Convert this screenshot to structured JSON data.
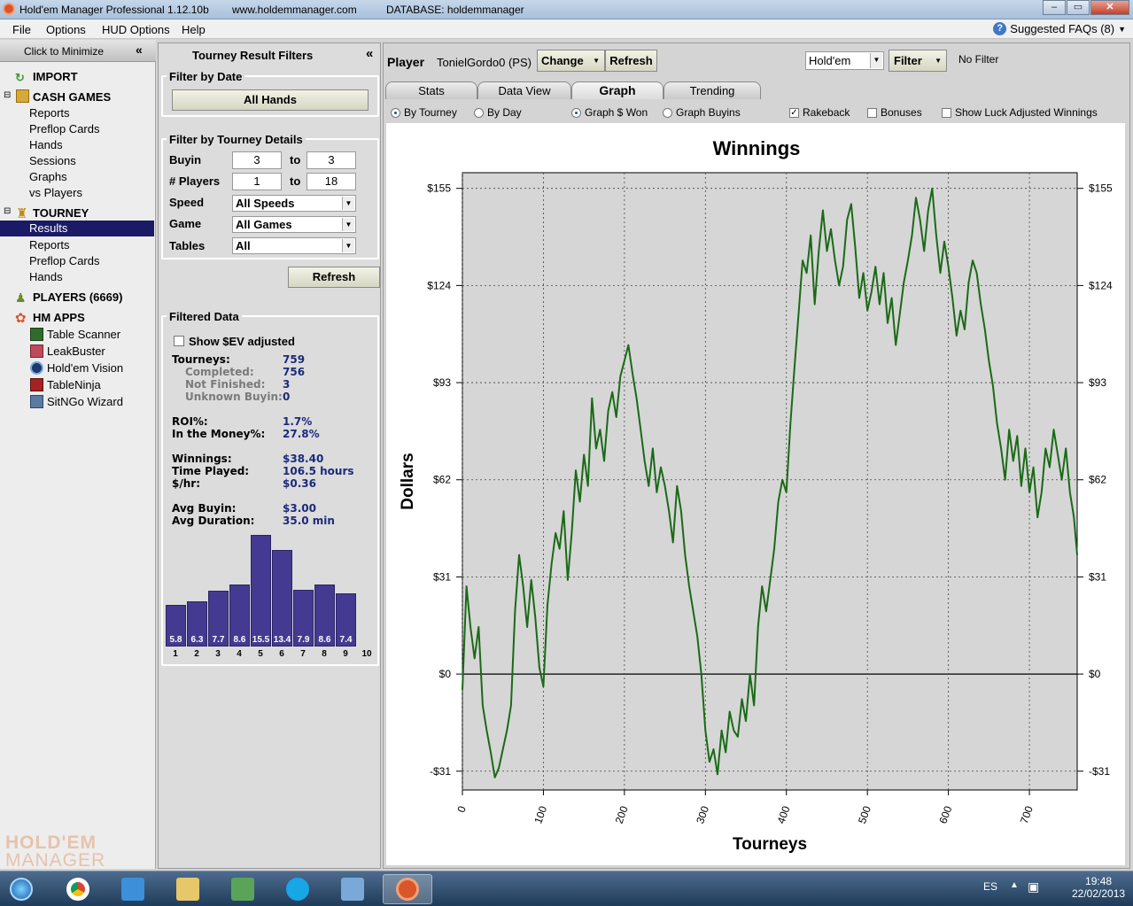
{
  "window": {
    "title": "Hold'em Manager Professional 1.12.10b",
    "website": "www.holdemmanager.com",
    "database": "DATABASE: holdemmanager"
  },
  "menu": [
    "File",
    "Options",
    "HUD Options",
    "Help"
  ],
  "faq": "Suggested FAQs (8)",
  "nav": {
    "minimize": "Click to Minimize",
    "import": "IMPORT",
    "cash_games": "CASH GAMES",
    "cash_items": [
      "Reports",
      "Preflop Cards",
      "Hands",
      "Sessions",
      "Graphs",
      "vs Players"
    ],
    "tourney": "TOURNEY",
    "tourney_items": [
      "Results",
      "Reports",
      "Preflop Cards",
      "Hands"
    ],
    "players": "PLAYERS (6669)",
    "hm_apps": "HM APPS",
    "apps": [
      "Table Scanner",
      "LeakBuster",
      "Hold'em Vision",
      "TableNinja",
      "SitNGo Wizard"
    ],
    "brand": [
      "HOLD'EM",
      "MANAGER"
    ]
  },
  "filters": {
    "title": "Tourney Result Filters",
    "by_date_title": "Filter by Date",
    "all_hands": "All Hands",
    "by_details_title": "Filter by Tourney Details",
    "buyin_label": "Buyin",
    "buyin_from": "3",
    "buyin_to": "3",
    "players_label": "# Players",
    "players_from": "1",
    "players_to": "18",
    "to": "to",
    "speed_label": "Speed",
    "speed_value": "All Speeds",
    "game_label": "Game",
    "game_value": "All Games",
    "tables_label": "Tables",
    "tables_value": "All",
    "refresh": "Refresh",
    "filtered_title": "Filtered Data",
    "show_ev": "Show $EV adjusted",
    "stats": [
      {
        "label": "Tourneys:",
        "value": "759",
        "sub": false
      },
      {
        "label": "Completed:",
        "value": "756",
        "sub": true
      },
      {
        "label": "Not Finished:",
        "value": "3",
        "sub": true
      },
      {
        "label": "Unknown Buyin:",
        "value": "0",
        "sub": true
      },
      {
        "label": "ROI%:",
        "value": "1.7%",
        "sub": false
      },
      {
        "label": "In the Money%:",
        "value": "27.8%",
        "sub": false
      },
      {
        "label": "Winnings:",
        "value": "$38.40",
        "sub": false
      },
      {
        "label": "Time Played:",
        "value": "106.5 hours",
        "sub": false
      },
      {
        "label": "$/hr:",
        "value": "$0.36",
        "sub": false
      },
      {
        "label": "Avg Buyin:",
        "value": "$3.00",
        "sub": false
      },
      {
        "label": "Avg Duration:",
        "value": "35.0 min",
        "sub": false
      }
    ],
    "histogram": {
      "positions": [
        "1",
        "2",
        "3",
        "4",
        "5",
        "6",
        "7",
        "8",
        "9",
        "10"
      ],
      "values": [
        5.8,
        6.3,
        7.7,
        8.6,
        15.5,
        13.4,
        7.9,
        8.6,
        7.4,
        null
      ],
      "labels": [
        "5.8",
        "6.3",
        "7.7",
        "8.6",
        "15.5",
        "13.4",
        "7.9",
        "8.6",
        "7.4",
        ""
      ],
      "color": "#453a91"
    }
  },
  "player_bar": {
    "player_label": "Player",
    "player_name": "TonielGordo0 (PS)",
    "change": "Change",
    "refresh": "Refresh",
    "game": "Hold'em",
    "filter": "Filter",
    "no_filter": "No Filter"
  },
  "tabs": [
    "Stats",
    "Data View",
    "Graph",
    "Trending"
  ],
  "active_tab": "Graph",
  "options": {
    "by_tourney": "By Tourney",
    "by_day": "By Day",
    "graph_won": "Graph $ Won",
    "graph_buyins": "Graph Buyins",
    "rakeback": "Rakeback",
    "bonuses": "Bonuses",
    "luck": "Show Luck Adjusted Winnings"
  },
  "chart_data": {
    "type": "line",
    "title": "Winnings",
    "xlabel": "Tourneys",
    "ylabel": "Dollars",
    "xlim": [
      0,
      759
    ],
    "ylim": [
      -37,
      160
    ],
    "x_ticks": [
      0,
      100,
      200,
      300,
      400,
      500,
      600,
      700
    ],
    "y_ticks": [
      155,
      124,
      93,
      62,
      31,
      0,
      -31
    ],
    "y_tick_labels": [
      "$155",
      "$124",
      "$93",
      "$62",
      "$31",
      "$0",
      "-$31"
    ],
    "grid": true,
    "line_color": "#1a6a16",
    "series": [
      {
        "x": [
          0,
          5,
          10,
          15,
          20,
          25,
          30,
          35,
          40,
          45,
          50,
          55,
          60,
          65,
          70,
          75,
          80,
          85,
          90,
          95,
          100,
          105,
          110,
          115,
          120,
          125,
          130,
          135,
          140,
          145,
          150,
          155,
          160,
          165,
          170,
          175,
          180,
          185,
          190,
          195,
          200,
          205,
          210,
          215,
          220,
          225,
          230,
          235,
          240,
          245,
          250,
          255,
          260,
          265,
          270,
          275,
          280,
          285,
          290,
          295,
          300,
          305,
          310,
          315,
          320,
          325,
          330,
          335,
          340,
          345,
          350,
          355,
          360,
          365,
          370,
          375,
          380,
          385,
          390,
          395,
          400,
          405,
          410,
          415,
          420,
          425,
          430,
          435,
          440,
          445,
          450,
          455,
          460,
          465,
          470,
          475,
          480,
          485,
          490,
          495,
          500,
          505,
          510,
          515,
          520,
          525,
          530,
          535,
          540,
          545,
          550,
          555,
          560,
          565,
          570,
          575,
          580,
          585,
          590,
          595,
          600,
          605,
          610,
          615,
          620,
          625,
          630,
          635,
          640,
          645,
          650,
          655,
          660,
          665,
          670,
          675,
          680,
          685,
          690,
          695,
          700,
          705,
          710,
          715,
          720,
          725,
          730,
          735,
          740,
          745,
          750,
          755,
          759
        ],
        "y": [
          -5,
          28,
          15,
          5,
          15,
          -10,
          -18,
          -25,
          -33,
          -30,
          -24,
          -18,
          -10,
          20,
          38,
          28,
          15,
          30,
          18,
          2,
          -4,
          22,
          35,
          45,
          40,
          52,
          30,
          45,
          65,
          55,
          70,
          60,
          88,
          72,
          78,
          68,
          84,
          90,
          82,
          95,
          100,
          105,
          96,
          88,
          78,
          68,
          60,
          72,
          58,
          66,
          60,
          52,
          42,
          60,
          52,
          38,
          28,
          20,
          12,
          0,
          -18,
          -28,
          -24,
          -32,
          -18,
          -25,
          -12,
          -18,
          -20,
          -8,
          -15,
          0,
          -10,
          15,
          28,
          20,
          30,
          40,
          55,
          62,
          58,
          80,
          98,
          115,
          132,
          128,
          140,
          118,
          135,
          148,
          135,
          142,
          132,
          124,
          130,
          145,
          150,
          136,
          120,
          128,
          116,
          122,
          130,
          118,
          128,
          112,
          120,
          105,
          115,
          125,
          132,
          140,
          152,
          145,
          135,
          148,
          155,
          140,
          128,
          138,
          130,
          120,
          108,
          116,
          110,
          125,
          132,
          128,
          118,
          110,
          100,
          92,
          80,
          72,
          62,
          78,
          68,
          76,
          60,
          72,
          58,
          66,
          50,
          58,
          72,
          66,
          78,
          70,
          62,
          72,
          58,
          50,
          38
        ]
      }
    ]
  }
}
